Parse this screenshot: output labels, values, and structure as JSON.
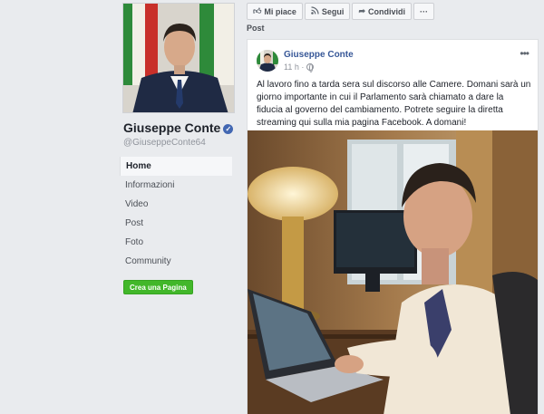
{
  "sidebar": {
    "page_name": "Giuseppe Conte",
    "verified_icon": "verified-badge-icon",
    "handle": "@GiuseppeConte64",
    "nav": [
      {
        "label": "Home",
        "active": true
      },
      {
        "label": "Informazioni",
        "active": false
      },
      {
        "label": "Video",
        "active": false
      },
      {
        "label": "Post",
        "active": false
      },
      {
        "label": "Foto",
        "active": false
      },
      {
        "label": "Community",
        "active": false
      }
    ],
    "create_page": "Crea una Pagina"
  },
  "actions": {
    "like": "Mi piace",
    "follow": "Segui",
    "share": "Condividi",
    "more": "···"
  },
  "section_title": "Post",
  "post": {
    "author": "Giuseppe Conte",
    "time": "11 h ·",
    "text": "Al lavoro fino a tarda sera sul discorso alle Camere. Domani sarà un giorno importante in cui il Parlamento sarà chiamato a dare la fiducia al governo del cambiamento. Potrete seguire la diretta streaming qui sulla mia pagina Facebook. A domani!"
  },
  "colors": {
    "background": "#e9ebee",
    "link": "#385898",
    "create_button": "#42b72a",
    "verified": "#4267b2"
  }
}
